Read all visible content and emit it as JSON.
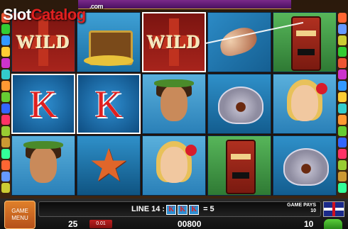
{
  "logo": {
    "prefix": "Slot",
    "accent": "Catalog",
    "suffix": ".com"
  },
  "reels": [
    [
      {
        "sym": "WILD",
        "type": "wild"
      },
      {
        "sym": "treasure-chest",
        "type": "chest"
      },
      {
        "sym": "WILD",
        "type": "wild",
        "hl": true
      },
      {
        "sym": "seashell",
        "type": "shell"
      },
      {
        "sym": "tiki-mask",
        "type": "tiki"
      }
    ],
    [
      {
        "sym": "K",
        "type": "k",
        "hl": true
      },
      {
        "sym": "K",
        "type": "k",
        "hl": true
      },
      {
        "sym": "man",
        "type": "man"
      },
      {
        "sym": "pearl-clam",
        "type": "clam"
      },
      {
        "sym": "girl",
        "type": "girl"
      }
    ],
    [
      {
        "sym": "man",
        "type": "man"
      },
      {
        "sym": "starfish",
        "type": "star"
      },
      {
        "sym": "girl",
        "type": "girl"
      },
      {
        "sym": "tiki-mask",
        "type": "tiki"
      },
      {
        "sym": "pearl-clam",
        "type": "clam"
      }
    ]
  ],
  "controls": {
    "menu_label": "GAME MENU",
    "line_prefix": "LINE 14 :",
    "line_symbol": "K",
    "line_result": "= 5",
    "game_pays_label": "GAME PAYS",
    "game_pays_value": "10",
    "bet_value": "25",
    "bet_button": "0.01",
    "credit": "00800",
    "win": "10"
  }
}
